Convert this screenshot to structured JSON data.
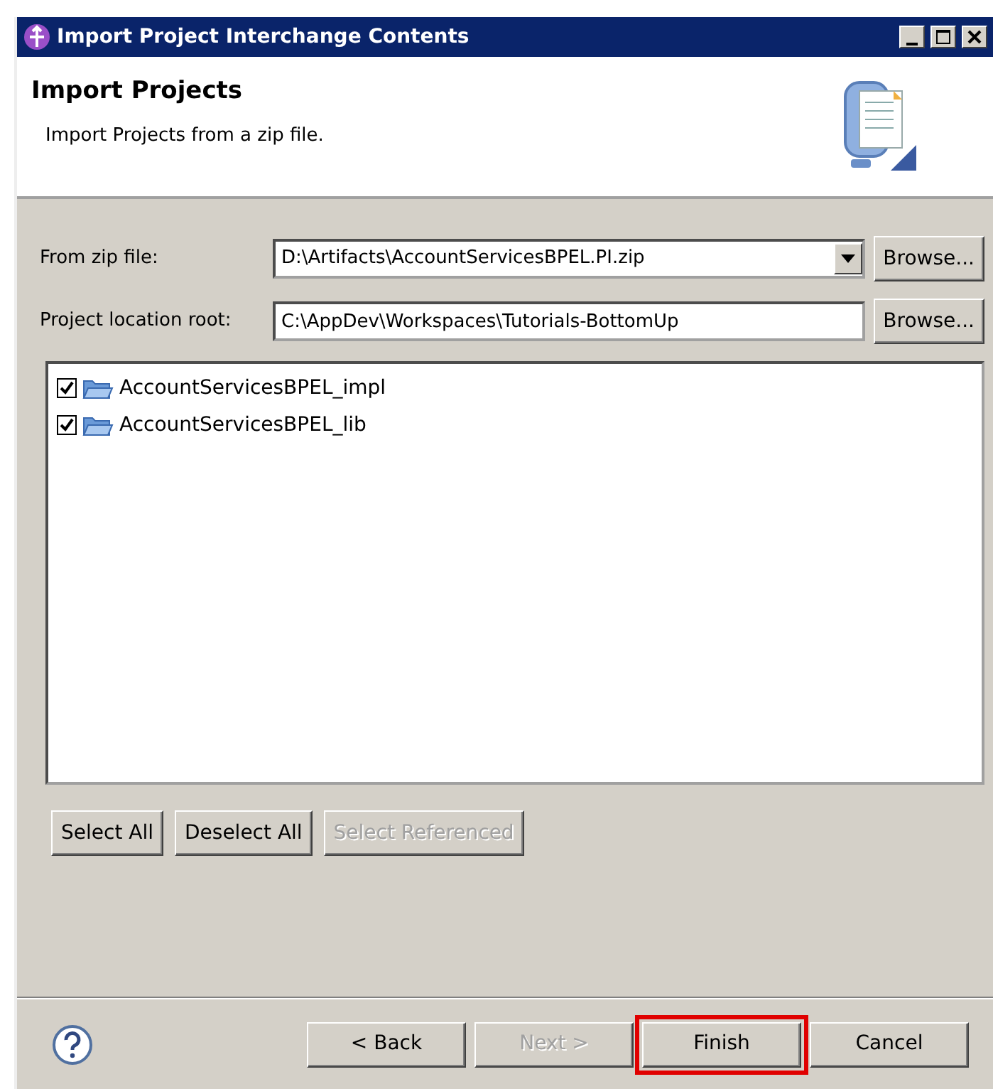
{
  "window": {
    "title": "Import Project Interchange Contents"
  },
  "header": {
    "title": "Import Projects",
    "description": "Import Projects from a zip file."
  },
  "fields": [
    {
      "kind": "combo",
      "label": "From zip file:",
      "value": "D:\\Artifacts\\AccountServicesBPEL.PI.zip",
      "button": "Browse..."
    },
    {
      "kind": "text",
      "label": "Project location root:",
      "value": "C:\\AppDev\\Workspaces\\Tutorials-BottomUp",
      "button": "Browse..."
    }
  ],
  "projects": [
    {
      "name": "AccountServicesBPEL_impl",
      "checked": true
    },
    {
      "name": "AccountServicesBPEL_lib",
      "checked": true
    }
  ],
  "selection_buttons": [
    {
      "label": "Select All",
      "disabled": false
    },
    {
      "label": "Deselect All",
      "disabled": false
    },
    {
      "label": "Select Referenced",
      "disabled": true
    }
  ],
  "footer_buttons": [
    {
      "label": "< Back",
      "disabled": false,
      "highlighted": false
    },
    {
      "label": "Next >",
      "disabled": true,
      "highlighted": false
    },
    {
      "label": "Finish",
      "disabled": false,
      "highlighted": true
    },
    {
      "label": "Cancel",
      "disabled": false,
      "highlighted": false
    }
  ]
}
